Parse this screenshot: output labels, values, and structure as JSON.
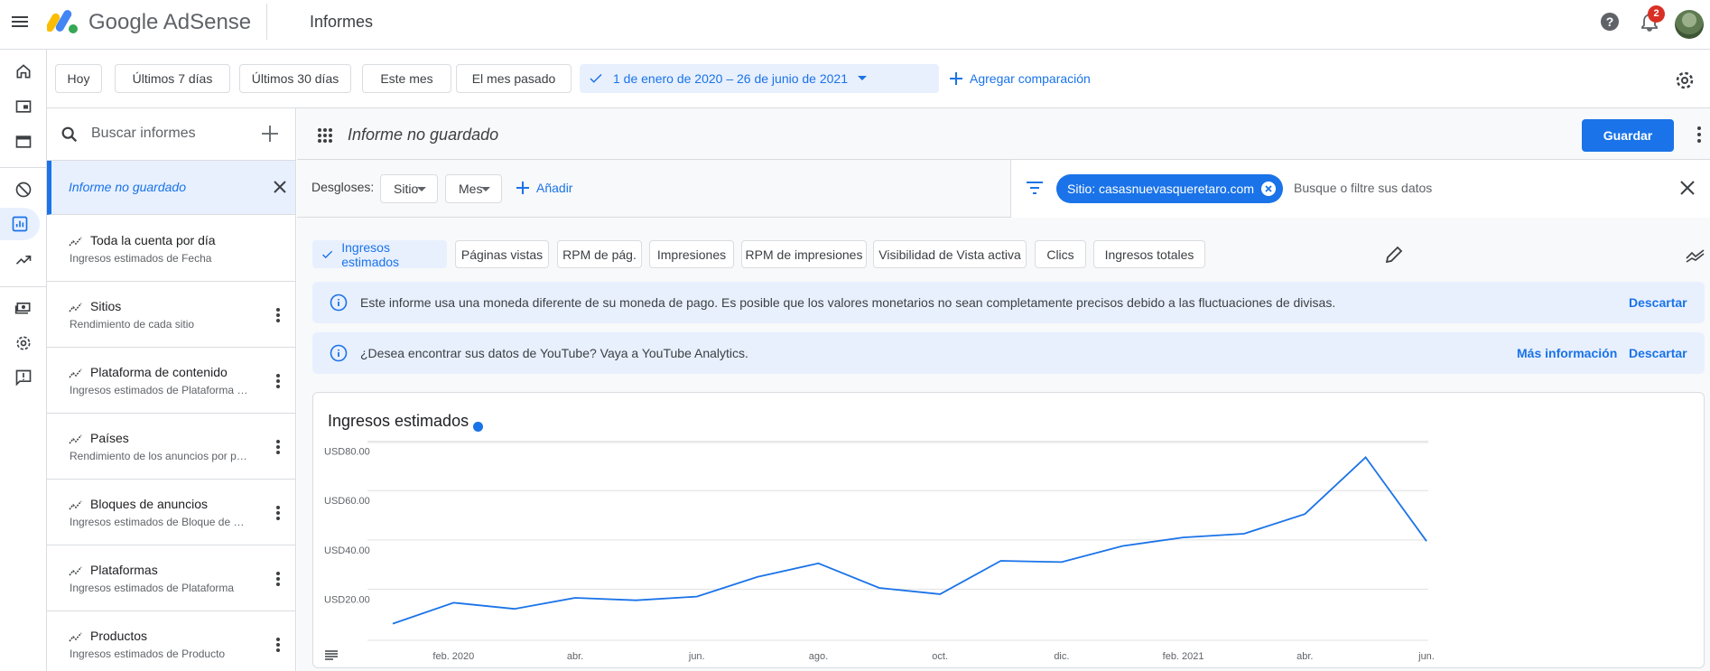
{
  "app": {
    "brand": "Google AdSense",
    "page_title": "Informes",
    "notifications_count": "2"
  },
  "rail": {
    "icons": [
      "home-icon",
      "ads-icon",
      "sites-icon",
      "block-icon",
      "reports-icon",
      "optimization-icon",
      "payments-icon",
      "settings-icon",
      "feedback-icon"
    ],
    "active": "reports-icon"
  },
  "date_range": {
    "presets": [
      "Hoy",
      "Últimos 7 días",
      "Últimos 30 días",
      "Este mes",
      "El mes pasado"
    ],
    "selected_range": "1 de enero de 2020 – 26 de junio de 2021",
    "add_comparison": "Agregar comparación"
  },
  "reports_panel": {
    "search_placeholder": "Buscar informes",
    "current_report": "Informe no guardado",
    "items": [
      {
        "name": "Toda la cuenta por día",
        "sub": "Ingresos estimados de Fecha"
      },
      {
        "name": "Sitios",
        "sub": "Rendimiento de cada sitio"
      },
      {
        "name": "Plataforma de contenido",
        "sub": "Ingresos estimados de Plataforma de contenido"
      },
      {
        "name": "Países",
        "sub": "Rendimiento de los anuncios por país"
      },
      {
        "name": "Bloques de anuncios",
        "sub": "Ingresos estimados de Bloque de anuncios"
      },
      {
        "name": "Plataformas",
        "sub": "Ingresos estimados de Plataforma"
      },
      {
        "name": "Productos",
        "sub": "Ingresos estimados de Producto"
      }
    ]
  },
  "report": {
    "title": "Informe no guardado",
    "save_label": "Guardar",
    "breakdowns_label": "Desgloses:",
    "breakdown_site": "Sitio",
    "breakdown_month": "Mes",
    "add_label": "Añadir",
    "filter_chip": "Sitio: casasnuevasqueretaro.com",
    "filter_placeholder": "Busque o filtre sus datos",
    "metrics": [
      "Ingresos estimados",
      "Páginas vistas",
      "RPM de pág.",
      "Impresiones",
      "RPM de impresiones",
      "Visibilidad de Vista activa",
      "Clics",
      "Ingresos totales"
    ],
    "selected_metric": "Ingresos estimados"
  },
  "banners": [
    {
      "message": "Este informe usa una moneda diferente de su moneda de pago. Es posible que los valores monetarios no sean completamente precisos debido a las fluctuaciones de divisas.",
      "action": "Descartar"
    },
    {
      "message": "¿Desea encontrar sus datos de YouTube? Vaya a YouTube Analytics.",
      "secondary_action": "Más información",
      "action": "Descartar"
    }
  ],
  "colors": {
    "accent": "#1a73e8",
    "banner": "#e8f0fe"
  },
  "chart_data": {
    "type": "line",
    "title": "Ingresos estimados",
    "series": [
      {
        "values": [
          6,
          14.5,
          12,
          16.5,
          15.5,
          17,
          25,
          30.5,
          20.5,
          18,
          31.5,
          31,
          37.5,
          41,
          42.5,
          50.5,
          73.5,
          39.5
        ]
      }
    ],
    "x": [
      "ene. 2020",
      "feb. 2020",
      "mar. 2020",
      "abr. 2020",
      "may. 2020",
      "jun. 2020",
      "jul. 2020",
      "ago. 2020",
      "sept. 2020",
      "oct. 2020",
      "nov. 2020",
      "dic. 2020",
      "ene. 2021",
      "feb. 2021",
      "mar. 2021",
      "abr. 2021",
      "may. 2021",
      "jun. 2021"
    ],
    "x_tick_labels": [
      "feb. 2020",
      "abr.",
      "jun.",
      "ago.",
      "oct.",
      "dic.",
      "feb. 2021",
      "abr.",
      "jun."
    ],
    "x_tick_indices": [
      1,
      3,
      5,
      7,
      9,
      11,
      13,
      15,
      17
    ],
    "y_ticks": [
      20,
      40,
      60,
      80
    ],
    "y_tick_labels": [
      "USD20.00",
      "USD40.00",
      "USD60.00",
      "USD80.00"
    ],
    "ylim": [
      0,
      85
    ],
    "grid": true
  }
}
